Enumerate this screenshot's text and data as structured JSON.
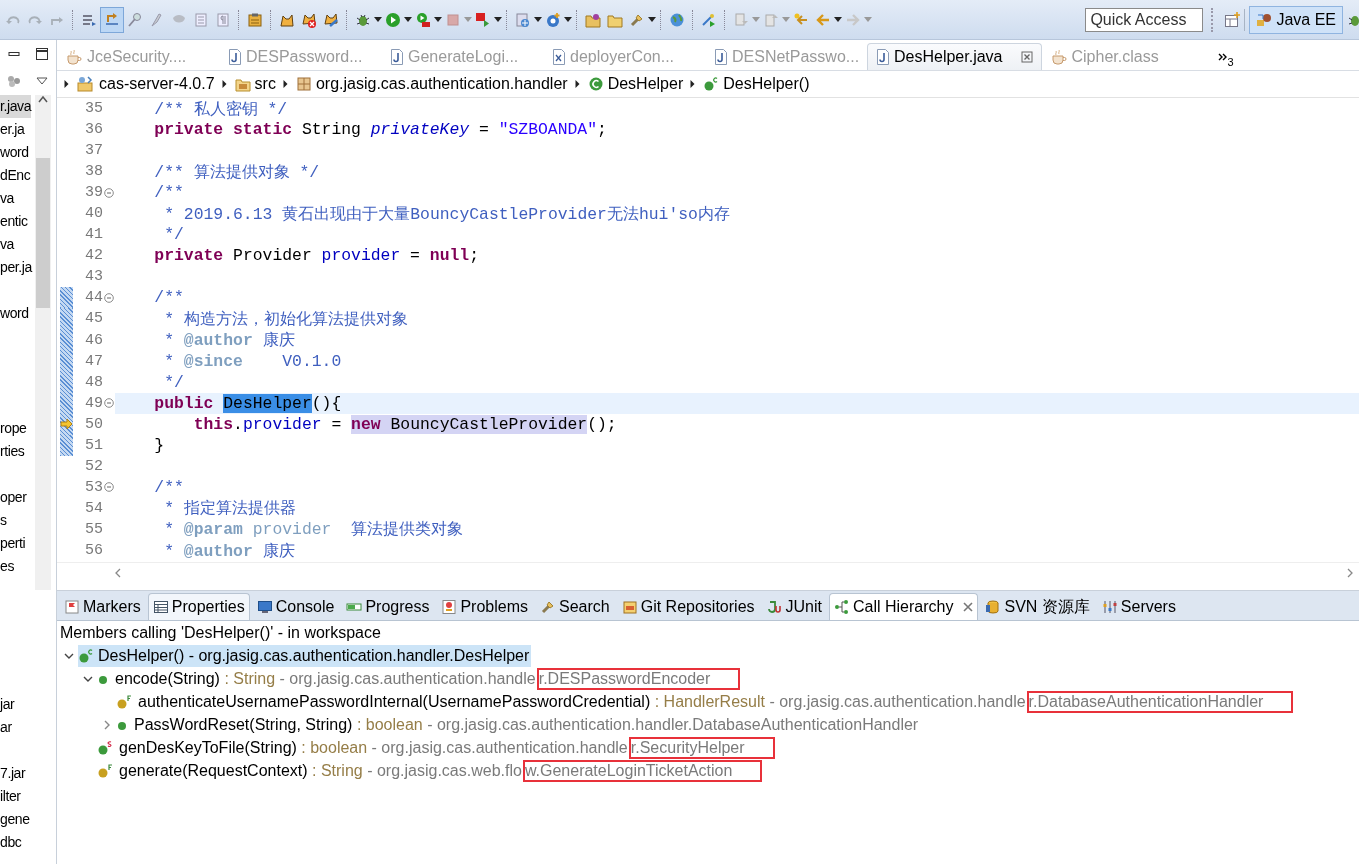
{
  "toolbar": {
    "toggle_button": {
      "on": true
    },
    "quick_access": {
      "placeholder": "Quick Access"
    },
    "perspectives": [
      {
        "label": "Java EE",
        "selected": true
      }
    ]
  },
  "explorer": {
    "rows": [
      {
        "kind": "item",
        "label": "r.java",
        "selected": true
      },
      {
        "kind": "item",
        "label": "er.ja",
        "selected": false
      },
      {
        "kind": "item",
        "label": "word",
        "selected": false
      },
      {
        "kind": "item",
        "label": "dEnc",
        "selected": false
      },
      {
        "kind": "item",
        "label": "va",
        "selected": false
      },
      {
        "kind": "item",
        "label": "entic",
        "selected": false
      },
      {
        "kind": "item",
        "label": "va",
        "selected": false
      },
      {
        "kind": "item",
        "label": "per.ja",
        "selected": false
      },
      {
        "kind": "gap"
      },
      {
        "kind": "item",
        "label": "word",
        "selected": false
      },
      {
        "kind": "gap"
      },
      {
        "kind": "gap"
      },
      {
        "kind": "gap"
      },
      {
        "kind": "gap"
      },
      {
        "kind": "item",
        "label": "rope",
        "selected": false
      },
      {
        "kind": "item",
        "label": "rties",
        "selected": false
      },
      {
        "kind": "gap"
      },
      {
        "kind": "item",
        "label": "oper",
        "selected": false
      },
      {
        "kind": "item",
        "label": "s",
        "selected": false
      },
      {
        "kind": "item",
        "label": "perti",
        "selected": false
      },
      {
        "kind": "item",
        "label": "es",
        "selected": false
      },
      {
        "kind": "gap"
      },
      {
        "kind": "gap"
      },
      {
        "kind": "gap"
      },
      {
        "kind": "gap"
      },
      {
        "kind": "gap"
      },
      {
        "kind": "item",
        "label": "jar",
        "selected": false
      },
      {
        "kind": "item",
        "label": "ar",
        "selected": false
      },
      {
        "kind": "gap"
      },
      {
        "kind": "item",
        "label": "7.jar",
        "selected": false
      },
      {
        "kind": "item",
        "label": "ilter",
        "selected": false
      },
      {
        "kind": "item",
        "label": "gene",
        "selected": false
      },
      {
        "kind": "item",
        "label": "dbc",
        "selected": false
      }
    ]
  },
  "editor": {
    "tabs": [
      {
        "label": "JceSecurity....",
        "kind": "class",
        "selected": false
      },
      {
        "label": "DESPassword...",
        "kind": "java",
        "selected": false
      },
      {
        "label": "GenerateLogi...",
        "kind": "java",
        "selected": false
      },
      {
        "label": "deployerCon...",
        "kind": "xml",
        "selected": false
      },
      {
        "label": "DESNetPasswo...",
        "kind": "java",
        "selected": false
      },
      {
        "label": "DesHelper.java",
        "kind": "java",
        "selected": true
      },
      {
        "label": "Cipher.class",
        "kind": "class",
        "selected": false
      }
    ],
    "overflow_count": "3",
    "breadcrumb": [
      {
        "label": "cas-server-4.0.7",
        "kind": "project"
      },
      {
        "label": "src",
        "kind": "folder"
      },
      {
        "label": "org.jasig.cas.authentication.handler",
        "kind": "package"
      },
      {
        "label": "DesHelper",
        "kind": "class"
      },
      {
        "label": "DesHelper()",
        "kind": "constructor"
      }
    ],
    "lines": [
      {
        "number": "35",
        "tokens": [
          {
            "kind": "comment",
            "text": "    /** 私人密钥 */"
          }
        ]
      },
      {
        "number": "36",
        "tokens": [
          {
            "kind": "keyword",
            "text": "    private static"
          },
          {
            "kind": "plain",
            "text": " String "
          },
          {
            "kind": "static_field",
            "text": "privateKey"
          },
          {
            "kind": "plain",
            "text": " = "
          },
          {
            "kind": "string",
            "text": "\"SZBOANDA\""
          },
          {
            "kind": "plain",
            "text": ";"
          }
        ]
      },
      {
        "number": "37"
      },
      {
        "number": "38",
        "tokens": [
          {
            "kind": "comment",
            "text": "    /** 算法提供对象 */"
          }
        ]
      },
      {
        "number": "39",
        "fold": true,
        "tokens": [
          {
            "kind": "comment",
            "text": "    /**"
          }
        ]
      },
      {
        "number": "40",
        "tokens": [
          {
            "kind": "comment",
            "text": "     * 2019.6.13 黄石出现由于大量BouncyCastleProvider无法hui'so内存"
          }
        ]
      },
      {
        "number": "41",
        "tokens": [
          {
            "kind": "comment",
            "text": "     */"
          }
        ]
      },
      {
        "number": "42",
        "tokens": [
          {
            "kind": "keyword",
            "text": "    private"
          },
          {
            "kind": "plain",
            "text": " Provider "
          },
          {
            "kind": "field",
            "text": "provider"
          },
          {
            "kind": "plain",
            "text": " = "
          },
          {
            "kind": "keyword",
            "text": "null"
          },
          {
            "kind": "plain",
            "text": ";"
          }
        ]
      },
      {
        "number": "43"
      },
      {
        "number": "44",
        "fold": true,
        "range": true,
        "tokens": [
          {
            "kind": "comment",
            "text": "    /**"
          }
        ]
      },
      {
        "number": "45",
        "range": true,
        "tokens": [
          {
            "kind": "comment",
            "text": "     * 构造方法，初始化算法提供对象"
          }
        ]
      },
      {
        "number": "46",
        "range": true,
        "tokens": [
          {
            "kind": "comment",
            "text": "     * "
          },
          {
            "kind": "tag",
            "text": "@author"
          },
          {
            "kind": "comment",
            "text": " 康庆"
          }
        ]
      },
      {
        "number": "47",
        "range": true,
        "tokens": [
          {
            "kind": "comment",
            "text": "     * "
          },
          {
            "kind": "tag",
            "text": "@since"
          },
          {
            "kind": "comment",
            "text": "    V0.1.0"
          }
        ]
      },
      {
        "number": "48",
        "range": true,
        "tokens": [
          {
            "kind": "comment",
            "text": "     */"
          }
        ]
      },
      {
        "number": "49",
        "fold": true,
        "range": true,
        "current": true,
        "tokens": [
          {
            "kind": "keyword",
            "text": "    public "
          },
          {
            "kind": "plain",
            "text": "DesHelper",
            "selection": true
          },
          {
            "kind": "plain",
            "text": "(){"
          }
        ]
      },
      {
        "number": "50",
        "range": true,
        "marker": true,
        "tokens": [
          {
            "kind": "keyword",
            "text": "        this"
          },
          {
            "kind": "plain",
            "text": "."
          },
          {
            "kind": "field",
            "text": "provider"
          },
          {
            "kind": "plain",
            "text": " = "
          },
          {
            "kind": "keyword",
            "text": "new",
            "occurrence": true
          },
          {
            "kind": "plain",
            "text": " BouncyCastleProvider",
            "occurrence": true
          },
          {
            "kind": "plain",
            "text": "();"
          }
        ]
      },
      {
        "number": "51",
        "range": true,
        "tokens": [
          {
            "kind": "plain",
            "text": "    }"
          }
        ]
      },
      {
        "number": "52"
      },
      {
        "number": "53",
        "fold": true,
        "tokens": [
          {
            "kind": "comment",
            "text": "    /**"
          }
        ]
      },
      {
        "number": "54",
        "tokens": [
          {
            "kind": "comment",
            "text": "     * 指定算法提供器"
          }
        ]
      },
      {
        "number": "55",
        "tokens": [
          {
            "kind": "comment",
            "text": "     * "
          },
          {
            "kind": "tag",
            "text": "@param"
          },
          {
            "kind": "tag_arg",
            "text": " provider"
          },
          {
            "kind": "comment",
            "text": "  算法提供类对象"
          }
        ]
      },
      {
        "number": "56",
        "tokens": [
          {
            "kind": "comment",
            "text": "     * "
          },
          {
            "kind": "tag",
            "text": "@author"
          },
          {
            "kind": "comment",
            "text": " 康庆"
          }
        ]
      }
    ]
  },
  "bottom_panel": {
    "tabs": [
      {
        "label": "Markers",
        "kind": "markers",
        "selected": false,
        "hovered": false
      },
      {
        "label": "Properties",
        "kind": "properties",
        "selected": false,
        "hovered": true
      },
      {
        "label": "Console",
        "kind": "console",
        "selected": false,
        "hovered": false
      },
      {
        "label": "Progress",
        "kind": "progress",
        "selected": false,
        "hovered": false
      },
      {
        "label": "Problems",
        "kind": "problems",
        "selected": false,
        "hovered": false
      },
      {
        "label": "Search",
        "kind": "search",
        "selected": false,
        "hovered": false
      },
      {
        "label": "Git Repositories",
        "kind": "git",
        "selected": false,
        "hovered": false
      },
      {
        "label": "JUnit",
        "kind": "junit",
        "selected": false,
        "hovered": false
      },
      {
        "label": "Call Hierarchy",
        "kind": "hierarchy",
        "selected": true,
        "hovered": false
      },
      {
        "label": "SVN 资源库",
        "kind": "svn",
        "selected": false,
        "hovered": false
      },
      {
        "label": "Servers",
        "kind": "servers",
        "selected": false,
        "hovered": false
      }
    ],
    "header": "Members calling 'DesHelper()' - in workspace",
    "tree": {
      "label": "DesHelper() - org.jasig.cas.authentication.handler.DesHelper",
      "kind": "constructor",
      "expanded": true,
      "selected": true,
      "children": [
        {
          "kind": "method",
          "signature": "encode(String)",
          "return_type": ": String",
          "qualifier": "- org.jasig.cas.authentication.handle",
          "type_name": "r.DESPasswordEncoder",
          "boxed": true,
          "expanded": true,
          "children": [
            {
              "kind": "final",
              "signature": "authenticateUsernamePasswordInternal(UsernamePasswordCredential)",
              "return_type": ": HandlerResult",
              "qualifier": "- org.jasig.cas.authentication.handle",
              "type_name": "r.DatabaseAuthenticationHandler",
              "boxed": true
            },
            {
              "kind": "method",
              "signature": "PassWordReset(String, String)",
              "return_type": ": boolean",
              "qualifier": "- org.jasig.cas.authentication.handle",
              "type_name": "r.DatabaseAuthenticationHandler",
              "boxed": false,
              "expanded": false
            }
          ]
        },
        {
          "kind": "static",
          "signature": "genDesKeyToFile(String)",
          "return_type": ": boolean",
          "qualifier": "- org.jasig.cas.authentication.handle",
          "type_name": "r.SecurityHelper",
          "boxed": true
        },
        {
          "kind": "final",
          "signature": "generate(RequestContext)",
          "return_type": ": String",
          "qualifier": "- org.jasig.cas.web.flo",
          "type_name": "w.GenerateLoginTicketAction",
          "boxed": true
        }
      ]
    }
  }
}
